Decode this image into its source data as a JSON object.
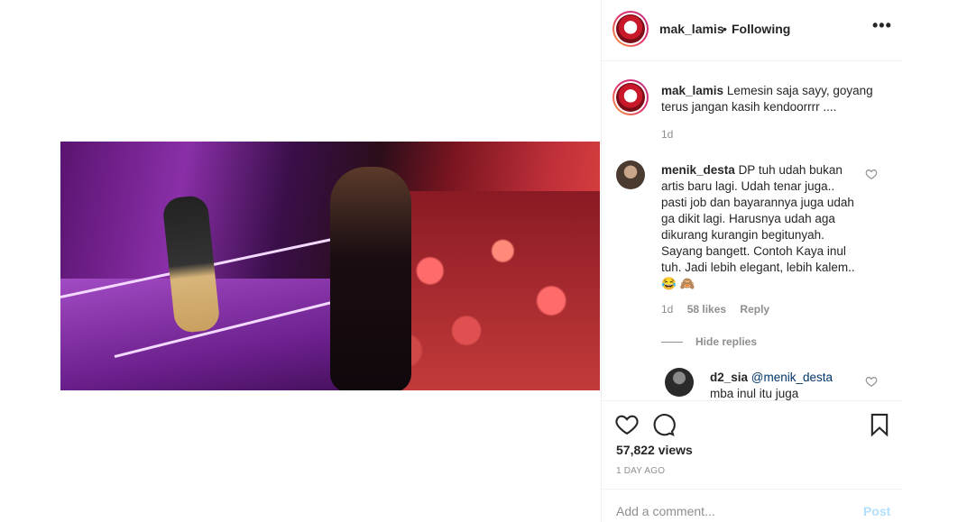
{
  "post": {
    "username": "mak_lamis",
    "separator": "•",
    "follow_status": "Following",
    "more_label": "•••"
  },
  "comments": [
    {
      "username": "mak_lamis",
      "text": "Lemesin saja sayy, goyang terus jangan kasih kendoorrrr ....",
      "time": "1d"
    },
    {
      "username": "menik_desta",
      "text": "DP tuh udah bukan artis baru lagi. Udah tenar juga.. pasti job dan bayarannya juga udah ga dikit lagi. Harusnya udah aga dikurang kurangin begitunyah. Sayang bangett. Contoh Kaya inul tuh. Jadi lebih elegant, lebih kalem.. 😂 🙈",
      "time": "1d",
      "likes": "58 likes",
      "reply_label": "Reply",
      "hide_replies_label": "Hide replies"
    },
    {
      "username": "d2_sia",
      "mention": "@menik_desta",
      "text": "mba inul itu juga"
    }
  ],
  "stats": {
    "views": "57,822 views",
    "time_ago": "1 DAY AGO"
  },
  "add_comment": {
    "placeholder": "Add a comment...",
    "post_label": "Post"
  },
  "icons": {
    "like": "heart-icon",
    "comment": "comment-icon",
    "save": "bookmark-icon",
    "more": "more-options-icon"
  },
  "colors": {
    "text": "#262626",
    "muted": "#8e8e8e",
    "link": "#003569",
    "post_disabled": "#b2dffc",
    "border": "#efefef"
  }
}
